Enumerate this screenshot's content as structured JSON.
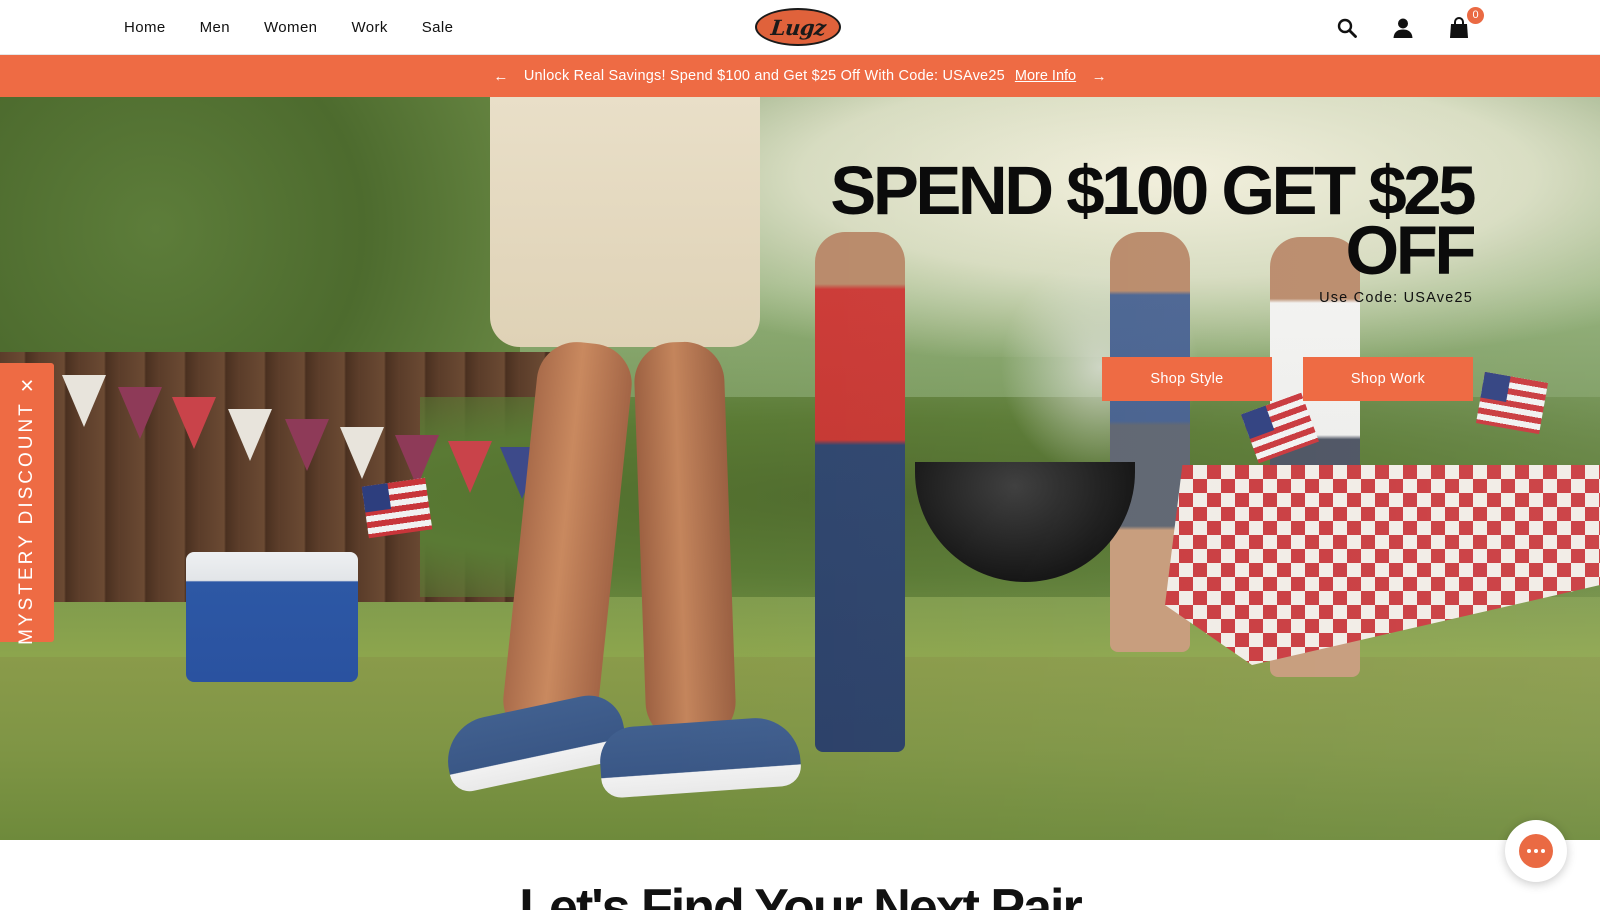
{
  "header": {
    "nav": [
      {
        "label": "Home"
      },
      {
        "label": "Men"
      },
      {
        "label": "Women"
      },
      {
        "label": "Work"
      },
      {
        "label": "Sale"
      }
    ],
    "logo_text": "Lugz",
    "cart_count": "0",
    "icons": [
      "search-icon",
      "account-icon",
      "shopping-bag-icon"
    ]
  },
  "promo_bar": {
    "message": "Unlock Real Savings! Spend $100 and Get $25 Off With Code: USAve25",
    "link_label": "More Info",
    "prev_arrow": "←",
    "next_arrow": "→"
  },
  "hero": {
    "headline_line1": "SPEND $100 GET $25",
    "headline_line2": "OFF",
    "code_text": "Use Code: USAve25",
    "buttons": [
      {
        "label": "Shop Style"
      },
      {
        "label": "Shop Work"
      }
    ]
  },
  "mystery_tab": {
    "label": "MYSTERY DISCOUNT",
    "close_glyph": "✕"
  },
  "section": {
    "title": "Let's Find Your Next Pair"
  },
  "colors": {
    "accent": "#ee6b44",
    "text": "#111111",
    "background": "#ffffff"
  }
}
